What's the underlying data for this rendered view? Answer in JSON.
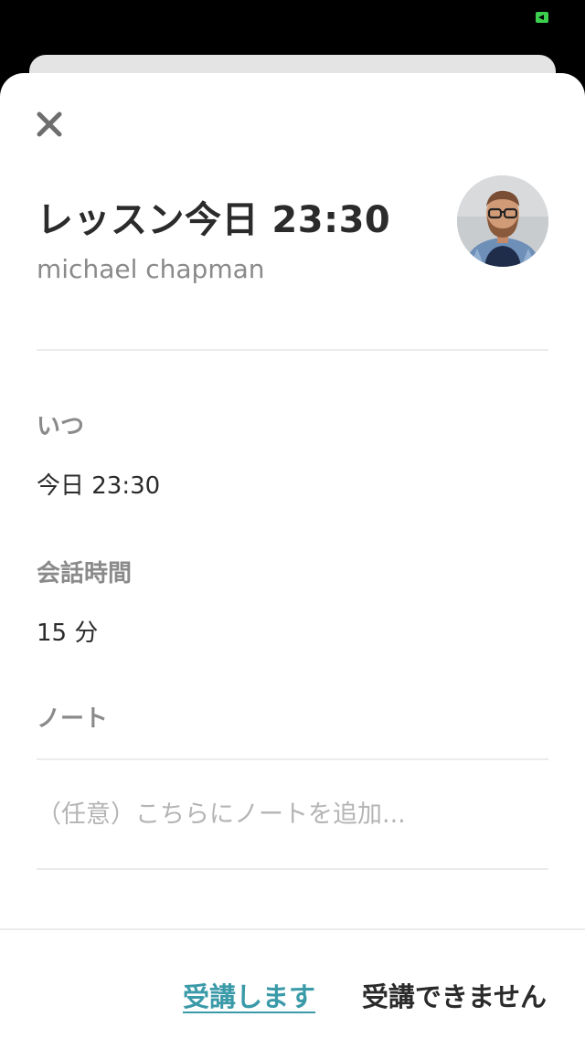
{
  "status_bar": {
    "battery_icon": "battery-charging-icon",
    "battery_color": "#3ccf4e"
  },
  "sheet": {
    "close_icon": "close-icon",
    "title": "レッスン今日 23:30",
    "subtitle": "michael chapman",
    "avatar_icon": "avatar-photo"
  },
  "details": {
    "when_label": "いつ",
    "when_value": "今日 23:30",
    "duration_label": "会話時間",
    "duration_value": "15 分",
    "note_label": "ノート",
    "note_placeholder": "（任意）こちらにノートを追加...",
    "note_value": ""
  },
  "footer": {
    "accept_label": "受講します",
    "accept_color": "#3a9aa8",
    "decline_label": "受講できません"
  }
}
